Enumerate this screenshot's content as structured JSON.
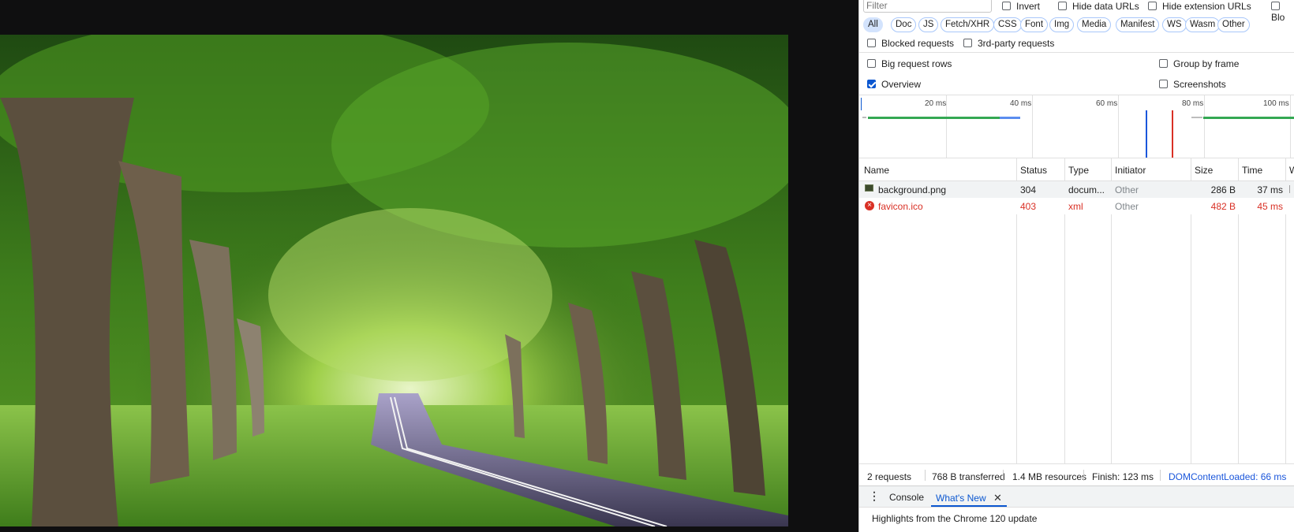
{
  "filter": {
    "placeholder": "Filter"
  },
  "filter_options": {
    "invert": "Invert",
    "hide_data_urls": "Hide data URLs",
    "hide_extension_urls": "Hide extension URLs",
    "blocked_cookies_partial": "Blo"
  },
  "type_chips": [
    "All",
    "Doc",
    "JS",
    "Fetch/XHR",
    "CSS",
    "Font",
    "Img",
    "Media",
    "Manifest",
    "WS",
    "Wasm",
    "Other"
  ],
  "active_chip": "All",
  "options": {
    "blocked_requests": "Blocked requests",
    "third_party": "3rd-party requests",
    "big_rows": "Big request rows",
    "group_by_frame": "Group by frame",
    "overview": "Overview",
    "screenshots": "Screenshots"
  },
  "overview_checked": true,
  "timeline_ticks": [
    "20 ms",
    "40 ms",
    "60 ms",
    "80 ms",
    "100 ms"
  ],
  "table": {
    "headers": {
      "name": "Name",
      "status": "Status",
      "type": "Type",
      "initiator": "Initiator",
      "size": "Size",
      "time": "Time",
      "waterfall": "W"
    },
    "rows": [
      {
        "name": "background.png",
        "status": "304",
        "type": "docum...",
        "initiator": "Other",
        "size": "286 B",
        "time": "37 ms",
        "error": false
      },
      {
        "name": "favicon.ico",
        "status": "403",
        "type": "xml",
        "initiator": "Other",
        "size": "482 B",
        "time": "45 ms",
        "error": true
      }
    ]
  },
  "summary": {
    "requests": "2 requests",
    "transferred": "768 B transferred",
    "resources": "1.4 MB resources",
    "finish": "Finish: 123 ms",
    "dcl": "DOMContentLoaded: 66 ms"
  },
  "drawer": {
    "tab_console": "Console",
    "tab_whats_new": "What's New",
    "content": "Highlights from the Chrome 120 update"
  },
  "colors": {
    "accent": "#0b57d0",
    "error": "#d93025",
    "dcl_line": "#1a56db",
    "load_line": "#d93025",
    "bar_green": "#34a853"
  }
}
